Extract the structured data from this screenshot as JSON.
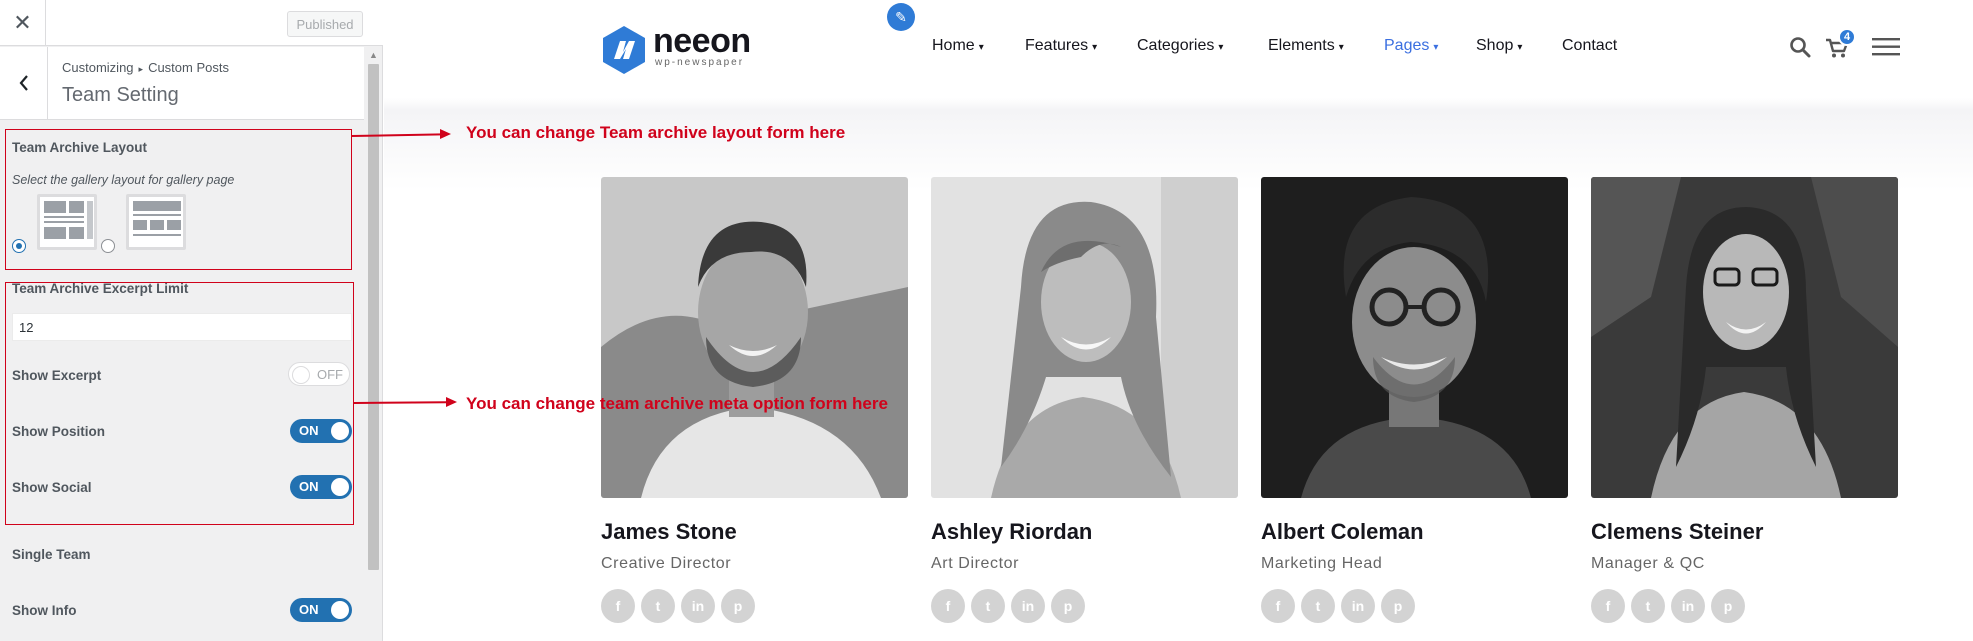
{
  "customizer": {
    "close_icon": "close-icon",
    "publish_label": "Published",
    "breadcrumb_root": "Customizing",
    "breadcrumb_sep": "▸",
    "breadcrumb_section": "Custom Posts",
    "section_title": "Team Setting",
    "archive_layout": {
      "label": "Team Archive Layout",
      "description": "Select the gallery layout for gallery page",
      "options": [
        {
          "name": "layout-grid-sidebar",
          "selected": true
        },
        {
          "name": "layout-list-wide",
          "selected": false
        }
      ]
    },
    "excerpt_limit": {
      "label": "Team Archive Excerpt Limit",
      "value": "12"
    },
    "toggles": [
      {
        "label": "Show Excerpt",
        "state": "OFF"
      },
      {
        "label": "Show Position",
        "state": "ON"
      },
      {
        "label": "Show Social",
        "state": "ON"
      }
    ],
    "single_team_heading": "Single Team",
    "single_toggles": [
      {
        "label": "Show Info",
        "state": "ON"
      }
    ]
  },
  "annotations": [
    "You can change Team archive layout form here",
    "You can change team archive meta option form here"
  ],
  "site": {
    "logo": {
      "name": "neeon",
      "tagline": "wp-newspaper"
    },
    "nav": [
      {
        "label": "Home",
        "dropdown": true,
        "active": false
      },
      {
        "label": "Features",
        "dropdown": true,
        "active": false
      },
      {
        "label": "Categories",
        "dropdown": true,
        "active": false
      },
      {
        "label": "Elements",
        "dropdown": true,
        "active": false
      },
      {
        "label": "Pages",
        "dropdown": true,
        "active": true
      },
      {
        "label": "Shop",
        "dropdown": true,
        "active": false
      },
      {
        "label": "Contact",
        "dropdown": false,
        "active": false
      }
    ],
    "cart_count": "4",
    "accent_color": "#3b6fe0",
    "team": [
      {
        "name": "James Stone",
        "position": "Creative Director"
      },
      {
        "name": "Ashley Riordan",
        "position": "Art Director"
      },
      {
        "name": "Albert Coleman",
        "position": "Marketing Head"
      },
      {
        "name": "Clemens Steiner",
        "position": "Manager & QC"
      }
    ],
    "social_icons": [
      "facebook-icon",
      "twitter-icon",
      "linkedin-icon",
      "pinterest-icon"
    ],
    "social_glyphs": [
      "f",
      "t",
      "in",
      "p"
    ]
  }
}
